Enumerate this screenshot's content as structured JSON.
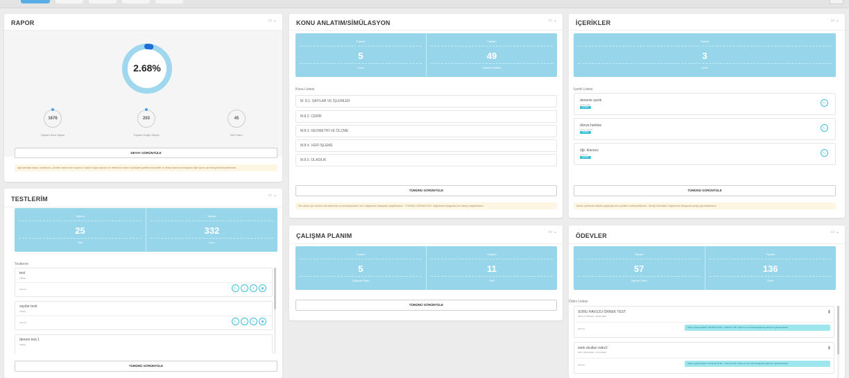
{
  "rapor": {
    "title": "RAPOR",
    "percent": "2.68%",
    "progress": 0.0268,
    "stats": [
      {
        "value": "1676",
        "label": "Toplam Soru Sayısı"
      },
      {
        "value": "203",
        "label": "Toplam Doğru Sayısı"
      },
      {
        "value": "45",
        "label": "Net Oranı"
      }
    ],
    "detail_button": "DETAY GÖRÜNTÜLE",
    "note": "İlgili alandaki başarı oranlarınız, çözülen toplam soru sayısını, toplam doğru sayısını ve netlerinizi oranını açıklayan grafikte bulunabilir ve detay butonuna tıklayarak ilgili raporu ayrıntılı görüntüleyebilirsiniz."
  },
  "konu": {
    "title": "KONU ANLATIM/SİMÜLASYON",
    "stats": [
      {
        "label": "Toplam",
        "value": "5",
        "caption": "Konu"
      },
      {
        "label": "Toplam",
        "value": "49",
        "caption": "Videolu Anlatım"
      }
    ],
    "list_label": "Konu Listesi",
    "items": [
      "M. 8.1. SAYILAR VE İŞLEMLER",
      "M.8.2. CEBİR",
      "M.8.3. GEOMETRİ VE ÖLÇME",
      "M.8.4. VERİ İŞLEME",
      "M.8.5. OLASILIK"
    ],
    "view_all": "TÜMÜNÜ GÖRÜNTÜLE",
    "note": "Her dersin için derslere ait anlatımlar ve simülasyonlara \"Ara\" düğmesine tıklayarak ulaşabilirsiniz. \"TÜMÜNÜ GÖRÜNTÜLE\" düğmesine tıklayarak tüm listeye ulaşabilirsiniz."
  },
  "icerikler": {
    "title": "İÇERİKLER",
    "stats": [
      {
        "label": "Toplam",
        "value": "3",
        "caption": "İçerik"
      }
    ],
    "list_label": "İçerik Listesi",
    "items": [
      {
        "title": "deneme içerik",
        "sub": "açıklamalar",
        "badge": "içerikler"
      },
      {
        "title": "dünya haritası",
        "sub": "dünya haritası",
        "badge": "içerikler"
      },
      {
        "title": "öğr. klavuzu",
        "sub": "kullanımı",
        "badge": "içerikler"
      }
    ],
    "view_all": "TÜMÜNÜ GÖRÜNTÜLE",
    "note": "Dersin içerisinde sizlerle paylaşılan tüm içerikleri inceleyebilirsiniz. \"İçeriği Görüntüle\" düğmesine tıklayarak içeriğe göz atabilirsiniz."
  },
  "testlerim": {
    "title": "TESTLERİM",
    "stats": [
      {
        "label": "Toplam",
        "value": "25",
        "caption": "Test"
      },
      {
        "label": "Toplam",
        "value": "332",
        "caption": "Soru"
      }
    ],
    "list_label": "Testlerim",
    "items": [
      {
        "title": "test",
        "sub": "Türkçe",
        "actions": "İşlemler"
      },
      {
        "title": "sayılar testi",
        "sub": "Türkçe",
        "actions": "İşlemler"
      },
      {
        "title": "denem test 1",
        "sub": "Türkçe",
        "actions": ""
      }
    ],
    "view_all": "TÜMÜNÜ GÖRÜNTÜLE"
  },
  "calisma": {
    "title": "ÇALIŞMA PLANIM",
    "stats": [
      {
        "label": "Toplam",
        "value": "5",
        "caption": "Çalışma Planı"
      },
      {
        "label": "Toplam",
        "value": "11",
        "caption": "Test"
      }
    ],
    "view_all": "TÜMÜNÜ GÖRÜNTÜLE"
  },
  "odevler": {
    "title": "ÖDEVLER",
    "stats": [
      {
        "label": "Toplam",
        "value": "57",
        "caption": "Yapılan Ödev"
      },
      {
        "label": "Toplam",
        "value": "136",
        "caption": "Ödev"
      }
    ],
    "list_label": "Ödev Listesi",
    "items": [
      {
        "title": "SORU HAVUZU ÖRNEK TEST",
        "sub": "Tarih: 27.06.2023 - 03.09.2023",
        "actions": "İşlemler",
        "status": "Ödevi yapma tarihleri: 28.08.23 15:04 - 3.09.23 17:09. Ödevi en son tarih aralığında yapmanız gerekmektedir."
      },
      {
        "title": "istek okulları ödev2",
        "sub": "Tarih: 20.06.2022 - 12.09.2023",
        "actions": "İşlemler",
        "status": "Ödevi yapma tarihleri: 20.06.22 16:00 - 1.09.23 11:09. Ödevi en son tarih aralığında yapmanız gerekmektedir."
      }
    ]
  },
  "icons": {
    "panel_ctrl": "expand-collapse-icon",
    "play": "play-icon",
    "trash": "trash-icon"
  },
  "colors": {
    "stat_bg": "#97d6ea",
    "ring_track": "#9fd8ee",
    "ring_fill": "#1f6fd9",
    "badge": "#3bbfd6"
  }
}
